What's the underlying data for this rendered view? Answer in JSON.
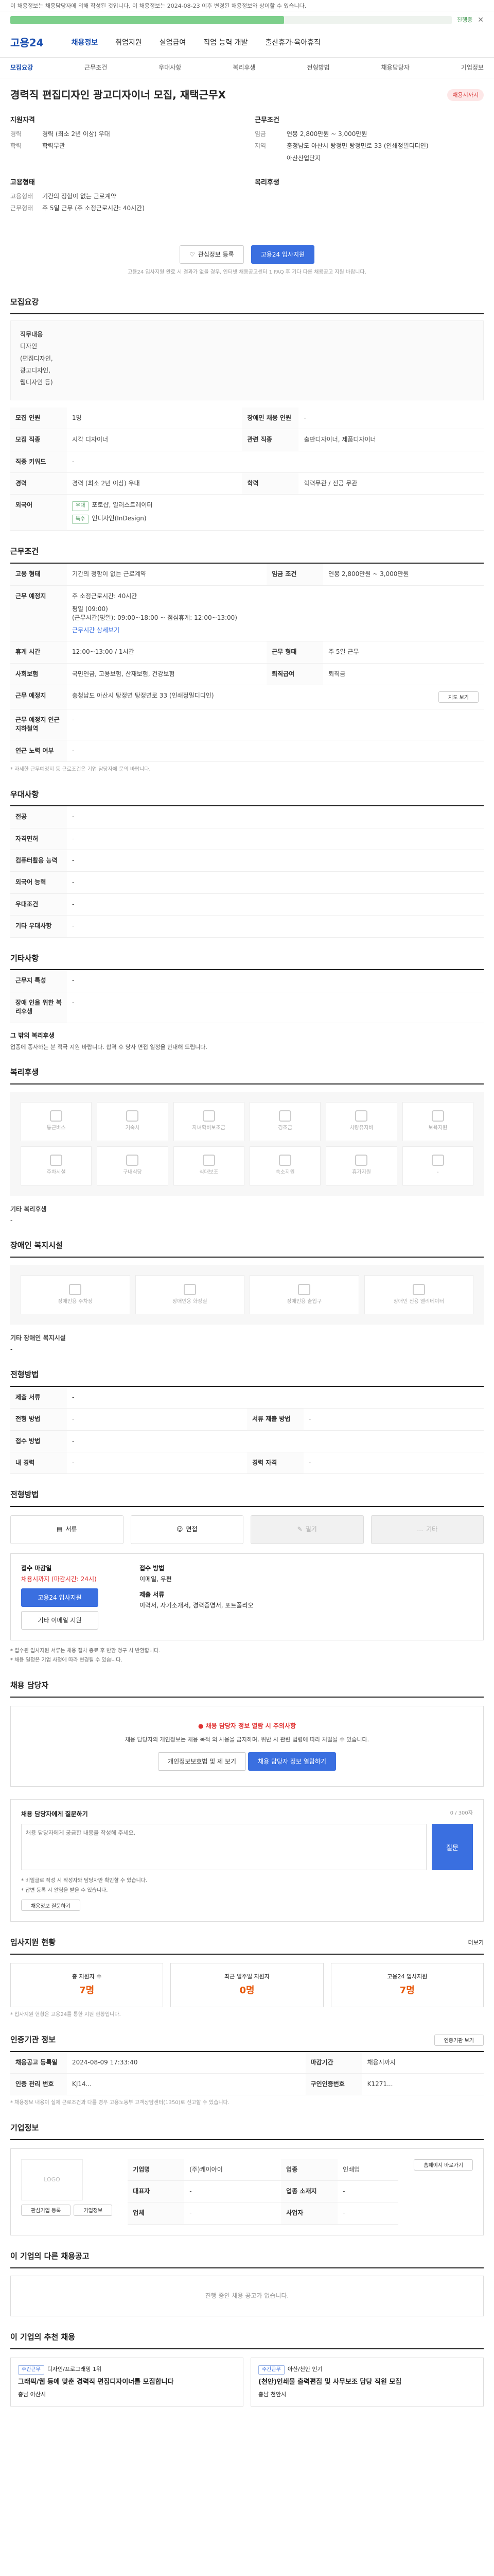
{
  "top_note": "이 채용정보는 채용담당자에 의해 작성된 것입니다. 이 채용정보는 2024-08-23 이후 변경된 채용정보와 상이할 수 있습니다.",
  "progress": {
    "fraction": 0.62,
    "text": "진행중",
    "close": "✕"
  },
  "gnb": {
    "logo": "고용24",
    "items": [
      "채용정보",
      "취업지원",
      "실업급여",
      "직업 능력 개발",
      "출산휴가·육아휴직"
    ]
  },
  "subnav": [
    "모집요강",
    "근무조건",
    "우대사항",
    "복리후생",
    "전형방법",
    "채용담당자",
    "기업정보"
  ],
  "job": {
    "title": "경력직 편집디자인 광고디자이너 모집, 재택근무X",
    "badge": "채용시까지",
    "left_label": "지원자격",
    "left": [
      {
        "k": "경력",
        "v": "경력 (최소 2년 이상) 우대"
      },
      {
        "k": "학력",
        "v": "학력무관"
      },
      {
        "k": "",
        "v": ""
      }
    ],
    "right_label": "근무조건",
    "right": [
      {
        "k": "임금",
        "v": "연봉 2,800만원 ~ 3,000만원"
      },
      {
        "k": "지역",
        "v": "충청남도 아산시 탕정면 탕정면로 33 (인쇄정밀디디인)"
      },
      {
        "k": "",
        "v": "아산산업단지"
      }
    ],
    "left2_label": "고용형태",
    "left2": [
      {
        "k": "고용형태",
        "v": "기간의 정함이 없는 근로계약"
      },
      {
        "k": "근무형태",
        "v": "주 5일 근무 (주 소정근로시간: 40시간)"
      }
    ],
    "right2_label": "복리후생",
    "right2": [
      {
        "k": "",
        "v": ""
      }
    ]
  },
  "apply": {
    "btn1": "관심정보 등록",
    "btn2": "고용24 입사지원",
    "note": "고용24 입사지원 완료 시 결과가 없을 경우, 인터넷 채용공고센터 1 FAQ 후 기다 다른 채용공고 지원 바랍니다."
  },
  "recruit": {
    "title": "모집요강",
    "duty_label": "직무내용",
    "duty_lines": [
      "디자인",
      "(편집디자인,",
      "광고디자인,",
      "웹디자인 등)"
    ],
    "rows": [
      {
        "k1": "모집 인원",
        "v1": "1명",
        "k2": "장애인 채용 인원",
        "v2": "-"
      },
      {
        "k1": "모집 직종",
        "v1": "시각 디자이너",
        "k2": "관련 직종",
        "v2": "출판디자이너, 제품디자이너"
      },
      {
        "k1": "직종 키워드",
        "v1": "-",
        "k2": "",
        "v2": ""
      },
      {
        "k1": "경력",
        "v1": "경력 (최소 2년 이상) 우대",
        "k2": "학력",
        "v2": "학력무관 / 전공 무관"
      }
    ],
    "lang_label": "외국어",
    "tags": [
      "우대",
      "특수"
    ],
    "tag_texts": [
      "포토샵, 일러스트레이터",
      "인디자인(InDesign)"
    ]
  },
  "work": {
    "title": "근무조건",
    "rows": [
      {
        "k1": "고용 형태",
        "v1": "기간의 정함이 없는 근로계약",
        "k2": "임금 조건",
        "v2": "연봉 2,800만원 ~ 3,000만원"
      },
      {
        "k1": "근무 예정지",
        "v1": "주 소정근로시간: 40시간",
        "k2": "",
        "v2": ""
      },
      {
        "k1": "",
        "v1": "평일 (09:00)",
        "k2": "",
        "v2": ""
      },
      {
        "k1": "",
        "v1": "(근무시간(평일): 09:00~18:00 ~ 점심휴게: 12:00~13:00)",
        "k2": "",
        "v2": ""
      }
    ],
    "schedule_link": "근무시간 상세보기",
    "rows2": [
      {
        "k1": "휴게 시간",
        "v1": "12:00~13:00 / 1시간",
        "k2": "근무 형태",
        "v2": "주 5일 근무"
      },
      {
        "k1": "사회보험",
        "v1": "국민연금, 고용보험, 산재보험, 건강보험",
        "k2": "퇴직급여",
        "v2": "퇴직금"
      },
      {
        "k1": "근무 예정지",
        "v1": "충청남도 아산시 탕정면 탕정면로 33 (인쇄정밀디디인)",
        "k2": "",
        "v2": ""
      },
      {
        "k1": "근무 예정지 인근 지하철역",
        "v1": "-",
        "k2": "",
        "v2": ""
      },
      {
        "k1": "연근 노력 여부",
        "v1": "-",
        "k2": "",
        "v2": ""
      }
    ],
    "map_btn": "지도 보기",
    "footnote": "* 자세한 근무예정지 등 근로조건은 기업 담당자에 문의 바랍니다."
  },
  "pref": {
    "title": "우대사항",
    "rows": [
      [
        "전공",
        "-"
      ],
      [
        "자격면허",
        "-"
      ],
      [
        "컴퓨터활용 능력",
        "-"
      ],
      [
        "외국어 능력",
        "-"
      ],
      [
        "우대조건",
        "-"
      ],
      [
        "기타 우대사항",
        "-"
      ]
    ]
  },
  "etc": {
    "title": "기타사항",
    "rows": [
      [
        "근무지 특성",
        "-"
      ],
      [
        "장애 인을 위한 복리후생",
        "-"
      ]
    ],
    "notes_label": "그 밖의 복리후생",
    "notes": "업종에 종사하는 분 적극 지원 바랍니다. 합격 후 당사 면접 일정을 안내해 드립니다."
  },
  "welfare": {
    "title": "복리후생",
    "items": [
      "통근버스",
      "기숙사",
      "자녀학비보조금",
      "경조금",
      "차량유지비",
      "보육지원",
      "주차시설",
      "구내식당",
      "식대보조",
      "숙소지원",
      "휴가지원",
      "-"
    ],
    "etc_label": "기타 복리후생",
    "etc_value": "-"
  },
  "disability": {
    "title": "장애인 복지시설",
    "items": [
      "장애인용 주차장",
      "장애인용 화장실",
      "장애인용 출입구",
      "장애인 전용 엘리베이터"
    ],
    "etc_label": "기타 장애인 복지시설",
    "etc_value": "-"
  },
  "screening": {
    "title": "전형방법",
    "rows": [
      [
        "제출 서류",
        "-"
      ],
      [
        "전형 방법",
        "-",
        "서류 제출 방법",
        "-"
      ],
      [
        "접수 방법",
        "-"
      ],
      [
        "내 경력",
        "-",
        "경력 자격",
        "-"
      ]
    ]
  },
  "process": {
    "title": "전형방법",
    "tabs": [
      "서류",
      "면접",
      "필기",
      "기타"
    ],
    "apply_label": "접수 마감일",
    "apply_note": "채용시까지 (마감시간: 24시)",
    "apply_btn": "고용24 입사지원",
    "other_btn": "기타 이메일 지원",
    "method_label": "접수 방법",
    "method_value": "이메일, 우편",
    "submit_label": "제출 서류",
    "submit_value": "이력서, 자기소개서, 경력증명서, 포트폴리오",
    "notes": [
      "* 접수된 입사지원 서류는 채용 절차 종료 후 반환 청구 시 반환합니다.",
      "* 채용 일정은 기업 사정에 따라 변경될 수 있습니다."
    ]
  },
  "manager": {
    "title": "채용 담당자",
    "alert": "채용 담당자 정보 열람 시 주의사항",
    "body": "채용 담당자의 개인정보는 채용 목적 외 사용을 금지하며, 위반 시 관련 법령에 따라 처벌될 수 있습니다.",
    "btn1": "개인정보보호법 및 제 보기",
    "btn2": "채용 담당자 정보 열람하기"
  },
  "qa": {
    "title": "채용 담당자에게 질문하기",
    "hint": "0 / 300자",
    "placeholder": "채용 담당자에게 궁금한 내용을 작성해 주세요.",
    "send": "질문",
    "notes": [
      "* 비밀글로 작성 시 작성자와 담당자만 확인할 수 있습니다.",
      "* 답변 등록 시 알림을 받을 수 있습니다."
    ],
    "link": "채용정보 질문하기"
  },
  "stats": {
    "title": "입사지원 현황",
    "more": "더보기",
    "cards": [
      {
        "label": "총 지원자 수",
        "value": "7명"
      },
      {
        "label": "최근 일주일 지원자",
        "value": "0명"
      },
      {
        "label": "고용24 입사지원",
        "value": "7명"
      }
    ],
    "note": "* 입사지원 현황은 고용24를 통한 지원 현황입니다."
  },
  "reg": {
    "title": "인증기관 정보",
    "btn": "인증기관 보기",
    "rows": [
      {
        "k1": "채용공고 등록일",
        "v1": "2024-08-09 17:33:40",
        "k2": "마감기간",
        "v2": "채용시까지"
      },
      {
        "k1": "인증 관리 번호",
        "v1": "KJ14...",
        "k2": "구인인증번호",
        "v2": "K1271..."
      }
    ],
    "notes": "* 채용정보 내용이 실제 근로조건과 다를 경우 고용노동부 고객상담센터(1350)로 신고할 수 있습니다."
  },
  "company": {
    "title": "기업정보",
    "logo": "LOGO",
    "btns": [
      "관심기업 등록",
      "기업정보"
    ],
    "rows": [
      [
        "기업명",
        "(주)케이아이",
        "업종",
        "인쇄업"
      ],
      [
        "대표자",
        "-",
        "업종 소재지",
        "-"
      ],
      [
        "업체",
        "-",
        "사업자",
        "-"
      ]
    ],
    "homepage_btn": "홈페이지 바로가기"
  },
  "others": {
    "title": "이 기업의 다른 채용공고",
    "empty": "진행 중인 채용 공고가 없습니다."
  },
  "recommend": {
    "title": "이 기업의 추천 채용",
    "cards": [
      {
        "tag": "주간근무",
        "meta": "디자인/프로그래밍 1위",
        "title": "그래픽/웹 등에 맞춘 경력직 편집디자이너를 모집합니다",
        "loc": "충남 아산시"
      },
      {
        "tag": "주간근무",
        "meta": "아산/천안 인기",
        "title": "(천안)인쇄물 출력편집 및 사무보조 담당 직원 모집",
        "loc": "충남 천안시"
      }
    ]
  }
}
